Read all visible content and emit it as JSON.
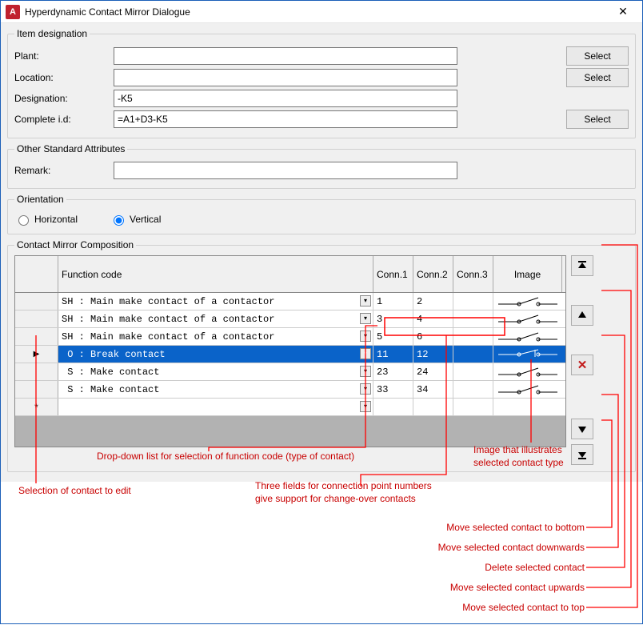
{
  "title": "Hyperdynamic Contact Mirror Dialogue",
  "item_designation": {
    "legend": "Item designation",
    "plant_label": "Plant:",
    "plant_value": "",
    "location_label": "Location:",
    "location_value": "",
    "designation_label": "Designation:",
    "designation_value": "-K5",
    "complete_id_label": "Complete i.d:",
    "complete_id_value": "=A1+D3-K5",
    "select_label": "Select"
  },
  "other_attributes": {
    "legend": "Other Standard Attributes",
    "remark_label": "Remark:",
    "remark_value": ""
  },
  "orientation": {
    "legend": "Orientation",
    "horizontal_label": "Horizontal",
    "vertical_label": "Vertical",
    "value": "vertical"
  },
  "composition": {
    "legend": "Contact Mirror Composition",
    "columns": {
      "function_code": "Function code",
      "conn1": "Conn.1",
      "conn2": "Conn.2",
      "conn3": "Conn.3",
      "image": "Image"
    },
    "rows": [
      {
        "fc": "SH : Main make contact of a contactor",
        "c1": "1",
        "c2": "2",
        "c3": "",
        "sym": "make",
        "sel": false
      },
      {
        "fc": "SH : Main make contact of a contactor",
        "c1": "3",
        "c2": "4",
        "c3": "",
        "sym": "make",
        "sel": false
      },
      {
        "fc": "SH : Main make contact of a contactor",
        "c1": "5",
        "c2": "6",
        "c3": "",
        "sym": "make",
        "sel": false
      },
      {
        "fc": " O : Break contact",
        "c1": "11",
        "c2": "12",
        "c3": "",
        "sym": "break",
        "sel": true
      },
      {
        "fc": " S : Make contact",
        "c1": "23",
        "c2": "24",
        "c3": "",
        "sym": "make",
        "sel": false
      },
      {
        "fc": " S : Make contact",
        "c1": "33",
        "c2": "34",
        "c3": "",
        "sym": "make",
        "sel": false
      }
    ]
  },
  "annotations": {
    "dd_list": "Drop-down list for selection of function code (type of contact)",
    "sel_edit": "Selection of contact to edit",
    "three_fields_1": "Three fields for connection point numbers",
    "three_fields_2": "give support for change-over contacts",
    "img_illus_1": "Image that illustrates",
    "img_illus_2": "selected contact type",
    "mv_bottom": "Move selected contact to bottom",
    "mv_down": "Move selected contact downwards",
    "del": "Delete selected contact",
    "mv_up": "Move selected contact upwards",
    "mv_top": "Move selected contact to top"
  }
}
